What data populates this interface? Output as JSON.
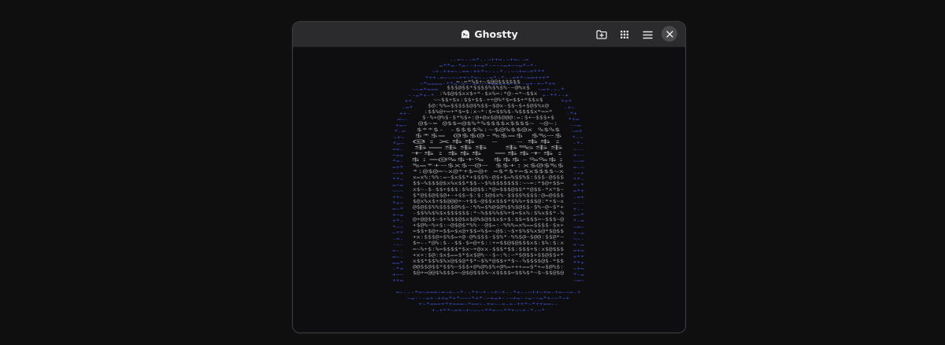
{
  "window": {
    "title": "Ghostty",
    "app_icon": "ghostty-icon",
    "buttons": [
      {
        "name": "new-tab-button",
        "icon": "folder-plus-icon"
      },
      {
        "name": "tab-overview-button",
        "icon": "grid-icon"
      },
      {
        "name": "menu-button",
        "icon": "hamburger-menu-icon"
      },
      {
        "name": "close-button",
        "icon": "close-icon"
      }
    ]
  },
  "terminal": {
    "content": "ascii-art-ghost-animation",
    "colors": {
      "body": "#9a9a9c",
      "outline": "#3a4bb8",
      "background": "#0e0e10"
    }
  },
  "colors": {
    "page_background": "#0f0f10",
    "titlebar": "#2b2b2d",
    "window_border": "#3b3b3e",
    "close_button": "#4a4a4d"
  }
}
